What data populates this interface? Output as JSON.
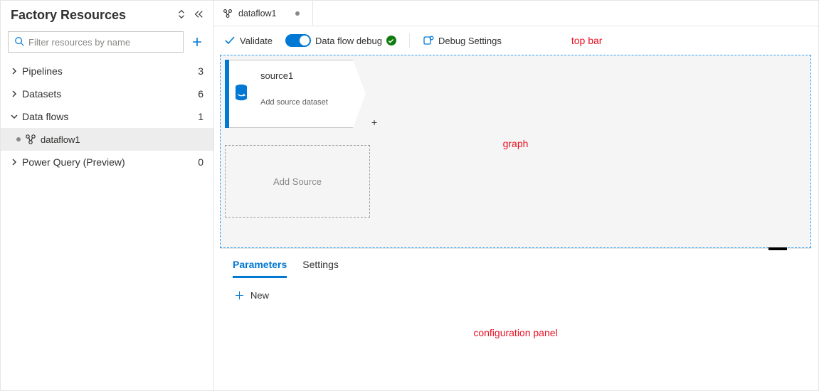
{
  "sidebar": {
    "title": "Factory Resources",
    "filter_placeholder": "Filter resources by name",
    "sections": [
      {
        "label": "Pipelines",
        "count": "3",
        "expanded": false
      },
      {
        "label": "Datasets",
        "count": "6",
        "expanded": false
      },
      {
        "label": "Data flows",
        "count": "1",
        "expanded": true,
        "children": [
          {
            "label": "dataflow1",
            "selected": true
          }
        ]
      },
      {
        "label": "Power Query (Preview)",
        "count": "0",
        "expanded": false
      }
    ]
  },
  "tabs": [
    {
      "title": "dataflow1",
      "dirty": true
    }
  ],
  "toolbar": {
    "validate_label": "Validate",
    "debug_toggle_label": "Data flow debug",
    "debug_toggle_on": true,
    "debug_status": "ok",
    "debug_settings_label": "Debug Settings"
  },
  "graph": {
    "source_node": {
      "title": "source1",
      "subtitle": "Add source dataset"
    },
    "add_placeholder_label": "Add Source"
  },
  "config": {
    "tabs": [
      {
        "label": "Parameters",
        "active": true
      },
      {
        "label": "Settings",
        "active": false
      }
    ],
    "new_label": "New"
  },
  "annotations": {
    "top_bar": "top bar",
    "graph": "graph",
    "config_panel": "configuration panel"
  }
}
